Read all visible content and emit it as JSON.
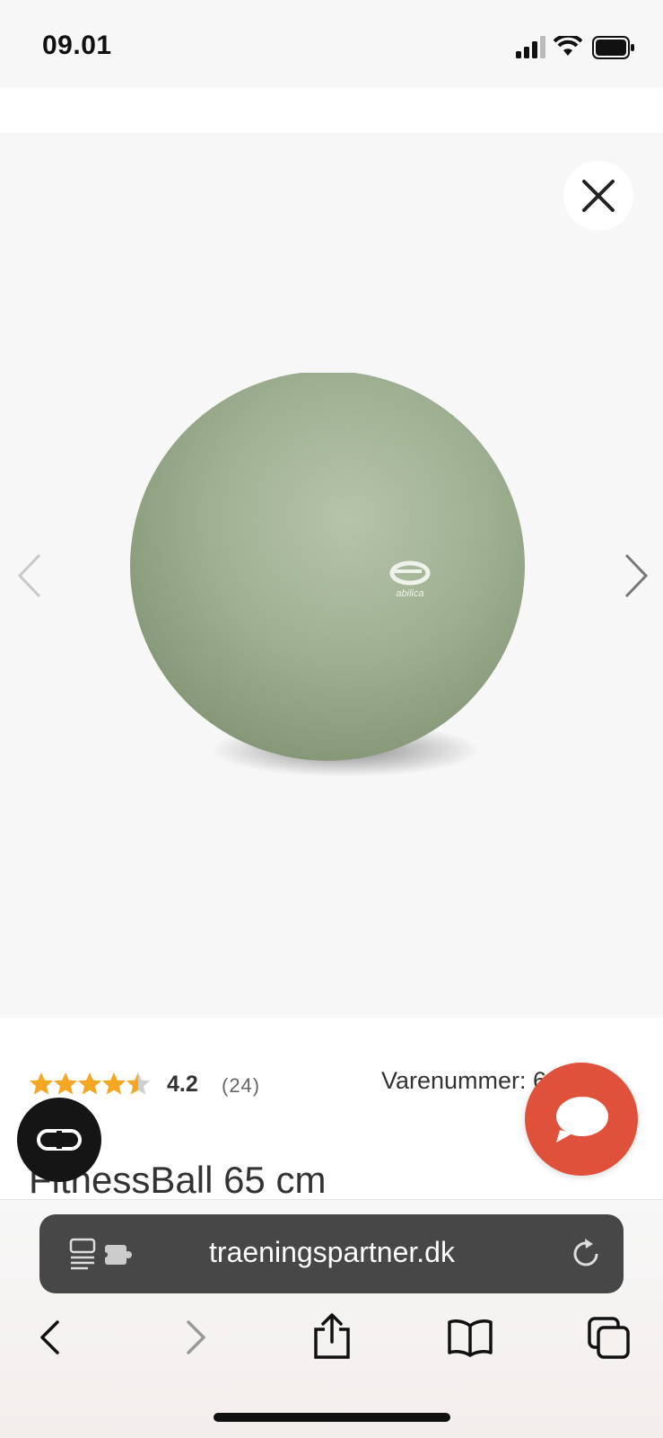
{
  "status_bar": {
    "time": "09.01"
  },
  "gallery": {
    "image_alt": "abilica FitnessBall green",
    "ball_logo_text": "abilica"
  },
  "product": {
    "rating": "4.2",
    "rating_value": 4.2,
    "review_count": "(24)",
    "sku_label": "Varenummer: 6",
    "brand": "a",
    "title": "FitnessBall 65 cm"
  },
  "browser": {
    "url": "traeningspartner.dk"
  },
  "colors": {
    "chat_button": "#e0513b",
    "url_bar": "#474747",
    "ball": "#98a98a",
    "star": "#f5a623"
  },
  "icons": [
    "close-icon",
    "chevron-left-icon",
    "chevron-right-icon",
    "chat-bubble-icon",
    "compare-icon",
    "reader-icon",
    "extension-icon",
    "reload-icon",
    "back-icon",
    "forward-icon",
    "share-icon",
    "bookmarks-icon",
    "tabs-icon",
    "signal-icon",
    "wifi-icon",
    "battery-icon"
  ]
}
